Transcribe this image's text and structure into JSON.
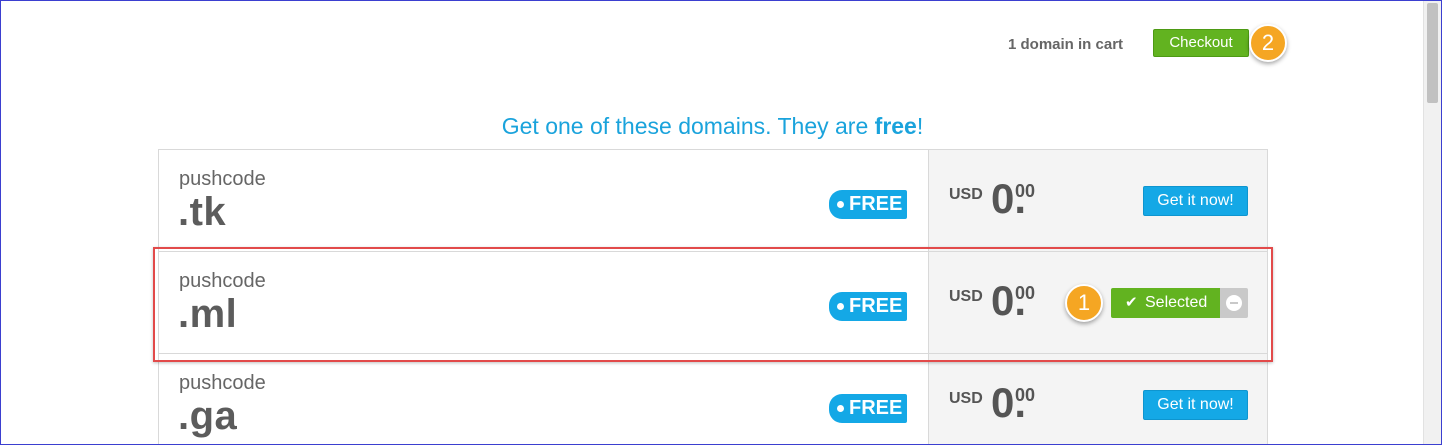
{
  "header": {
    "cart_count": "1 domain in cart",
    "checkout_label": "Checkout"
  },
  "headline": {
    "prefix": "Get one of these domains. They are ",
    "emphasis": "free",
    "suffix": "!"
  },
  "rows": [
    {
      "name": "pushcode",
      "tld": ".tk",
      "badge": "FREE",
      "currency": "USD",
      "price_int": "0.",
      "price_dec": "00",
      "action": "Get it now!"
    },
    {
      "name": "pushcode",
      "tld": ".ml",
      "badge": "FREE",
      "currency": "USD",
      "price_int": "0.",
      "price_dec": "00",
      "action": "Selected"
    },
    {
      "name": "pushcode",
      "tld": ".ga",
      "badge": "FREE",
      "currency": "USD",
      "price_int": "0.",
      "price_dec": "00",
      "action": "Get it now!"
    }
  ],
  "callouts": [
    "1",
    "2"
  ],
  "icons": {
    "selected": "check-icon",
    "remove": "minus-circle-icon"
  },
  "colors": {
    "accent_blue": "#14a8e6",
    "accent_green": "#62b320",
    "callout_orange": "#f5a623",
    "highlight_red": "#e24a4a"
  }
}
